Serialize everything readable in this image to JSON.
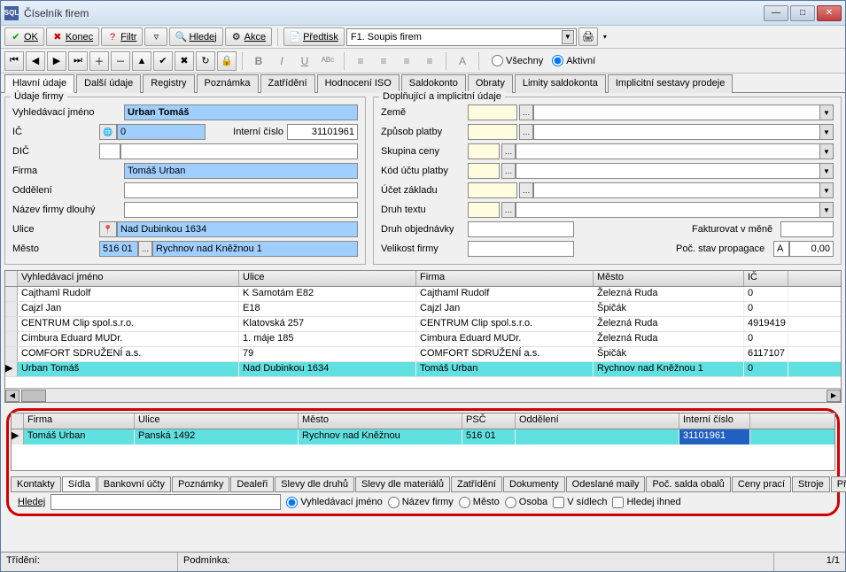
{
  "window": {
    "title": "Číselník firem"
  },
  "toolbar": {
    "ok": "OK",
    "konec": "Konec",
    "filtr": "Filtr",
    "hledej": "Hledej",
    "akce": "Akce",
    "predtisk": "Předtisk",
    "combo_value": "F1. Soupis firem"
  },
  "radios": {
    "vsechny": "Všechny",
    "aktivni": "Aktivní"
  },
  "tabs": [
    "Hlavní údaje",
    "Další údaje",
    "Registry",
    "Poznámka",
    "Zatřídění",
    "Hodnocení ISO",
    "Saldokonto",
    "Obraty",
    "Limity saldokonta",
    "Implicitní sestavy prodeje"
  ],
  "active_tab": 0,
  "left_fs": {
    "title": "Údaje firmy",
    "vyhled_label": "Vyhledávací jméno",
    "vyhled_value": "Urban Tomáš",
    "ic_label": "IČ",
    "ic_value": "0",
    "interni_label": "Interní číslo",
    "interni_value": "31101961",
    "dic_label": "DIČ",
    "dic_value": "",
    "firma_label": "Firma",
    "firma_value": "Tomáš Urban",
    "oddeleni_label": "Oddělení",
    "oddeleni_value": "",
    "nazev_label": "Název firmy dlouhý",
    "nazev_value": "",
    "ulice_label": "Ulice",
    "ulice_value": "Nad Dubinkou 1634",
    "mesto_label": "Město",
    "mesto_code": "516 01",
    "mesto_value": "Rychnov nad Kněžnou 1"
  },
  "right_fs": {
    "title": "Doplňující a implicitní údaje",
    "zeme": "Země",
    "zpusob": "Způsob platby",
    "skupina": "Skupina ceny",
    "kod": "Kód účtu platby",
    "ucet": "Účet základu",
    "druh": "Druh textu",
    "druh_obj": "Druh objednávky",
    "fakturovat": "Fakturovat v měně",
    "velikost": "Velikost firmy",
    "poc_stav": "Poč. stav propagace",
    "poc_stav_code": "A",
    "poc_stav_num": "0,00"
  },
  "grid": {
    "cols": [
      "Vyhledávací jméno",
      "Ulice",
      "Firma",
      "Město",
      "IČ"
    ],
    "widths": [
      250,
      200,
      200,
      170,
      50
    ],
    "rows": [
      [
        "Cajthaml Rudolf",
        "K Samotám      E82",
        "Cajthaml Rudolf",
        "Železná Ruda",
        "0"
      ],
      [
        "Cajzl Jan",
        "E18",
        "Cajzl Jan",
        "Špičák",
        "0"
      ],
      [
        "CENTRUM Clip spol.s.r.o.",
        "Klatovská        257",
        "CENTRUM Clip spol.s.r.o.",
        "Železná Ruda",
        "4919419"
      ],
      [
        "Cimbura Eduard MUDr.",
        "1. máje           185",
        "Cimbura Eduard MUDr.",
        "Železná Ruda",
        "0"
      ],
      [
        "COMFORT SDRUŽENÍ a.s.",
        "79",
        "COMFORT SDRUŽENÍ a.s.",
        "Špičák",
        "6117107"
      ],
      [
        "Urban Tomáš",
        "Nad Dubinkou 1634",
        "Tomáš Urban",
        "Rychnov nad Kněžnou 1",
        "0"
      ]
    ],
    "selected": 5
  },
  "subgrid": {
    "cols": [
      "Firma",
      "Ulice",
      "Město",
      "PSČ",
      "Oddělení",
      "Interní číslo"
    ],
    "widths": [
      125,
      185,
      185,
      60,
      185,
      80
    ],
    "row": [
      "Tomáš Urban",
      "Panská 1492",
      "Rychnov nad Kněžnou",
      "516 01",
      "",
      "31101961"
    ]
  },
  "subtabs": [
    "Kontakty",
    "Sídla",
    "Bankovní účty",
    "Poznámky",
    "Dealeři",
    "Slevy dle druhů",
    "Slevy dle materiálů",
    "Zatřídění",
    "Dokumenty",
    "Odeslané maily",
    "Poč. salda obalů",
    "Ceny prací",
    "Stroje",
    "Příteb"
  ],
  "active_subtab": 1,
  "search": {
    "label": "Hledej",
    "r1": "Vyhledávací jméno",
    "r2": "Název firmy",
    "r3": "Město",
    "r4": "Osoba",
    "c1": "V sídlech",
    "c2": "Hledej ihned"
  },
  "status": {
    "trideni": "Třídění:",
    "podminka": "Podmínka:",
    "counter": "1/1"
  }
}
